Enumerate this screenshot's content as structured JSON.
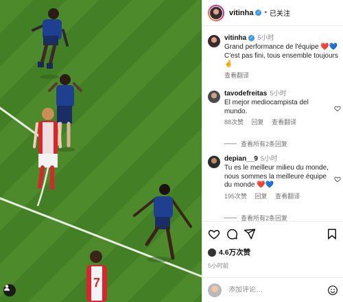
{
  "post": {
    "photo_alt": "football match photo",
    "header": {
      "username": "vitinha",
      "follow_label": "已关注",
      "separator": "•"
    },
    "caption": {
      "username": "vitinha",
      "time": "5小时",
      "text": "Grand performance de l'équipe ❤️💙\nC'est pas fini, tous ensemble toujours 🤞",
      "translate_label": "查看翻译"
    },
    "comments": [
      {
        "username": "tavodefreitas",
        "time": "5小时",
        "text": "El mejor mediocampista del mundo.",
        "likes": "88次赞",
        "reply_label": "回复",
        "translate_label": "查看翻译",
        "view_replies": "查看所有2条回复"
      },
      {
        "username": "depian__9",
        "time": "5小时",
        "text": "Tu es le meilleur milieu du monde, nous sommes la meilleure équipe du monde ❤️💙",
        "likes": "195次赞",
        "reply_label": "回复",
        "translate_label": "查看翻译",
        "view_replies": "查看所有2条回复"
      }
    ],
    "likes_count": "4.6万次赞",
    "posted_time": "5小时前",
    "comment_placeholder": "添加评论…",
    "colors": {
      "verified": "#3897f0",
      "heart": "#e8405e",
      "blue_heart": "#3b7ddd",
      "pitch": "#4c8a2c",
      "psg_kit": "#1f3f8f",
      "arsenal_kit": "#d8262e"
    },
    "icons": [
      "heart-icon",
      "comment-icon",
      "share-icon",
      "bookmark-icon",
      "emoji-icon",
      "verified-icon",
      "user-tag-icon"
    ]
  }
}
